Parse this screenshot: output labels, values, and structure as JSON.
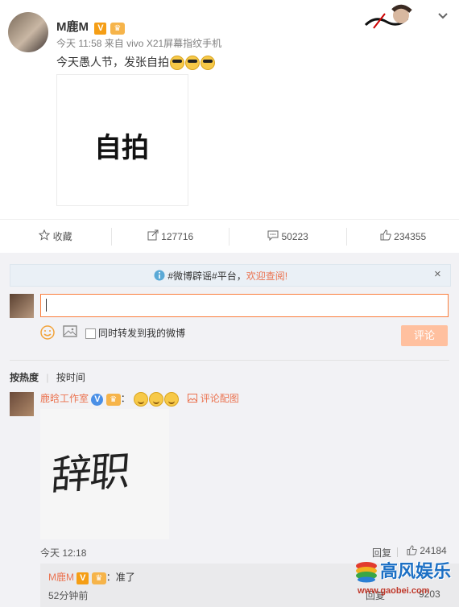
{
  "post": {
    "username": "M鹿M",
    "verified_badge": "V",
    "meta": "今天 11:58 来自 vivo X21屏幕指纹手机",
    "text": "今天愚人节，发张自拍",
    "photo_text": "自拍"
  },
  "actions": {
    "favorite": "收藏",
    "repost_count": "127716",
    "comment_count": "50223",
    "like_count": "234355"
  },
  "notice": {
    "prefix": "#微博辟谣#平台，",
    "link": "欢迎查阅!",
    "close": "×"
  },
  "composer": {
    "checkbox_label": "同时转发到我的微博",
    "submit_label": "评论"
  },
  "sort": {
    "by_heat": "按热度",
    "by_time": "按时间"
  },
  "comment": {
    "username": "鹿晗工作室",
    "verified_badge": "V",
    "colon": "：",
    "image_link": "评论配图",
    "handwriting_text": "辞职",
    "time": "今天 12:18",
    "reply_label": "回复",
    "like_count": "24184"
  },
  "reply": {
    "username": "M鹿M",
    "verified_badge": "V",
    "text": "：准了",
    "time": "52分钟前",
    "reply_label": "回复",
    "like_count": "9203"
  },
  "watermark": {
    "brand": "高风娱乐",
    "url": "www.gaobei.com"
  },
  "colors": {
    "accent_orange": "#fa7d3c",
    "link_orange": "#eb7350",
    "badge_orange": "#f59e15",
    "link_blue": "#eb7350"
  }
}
